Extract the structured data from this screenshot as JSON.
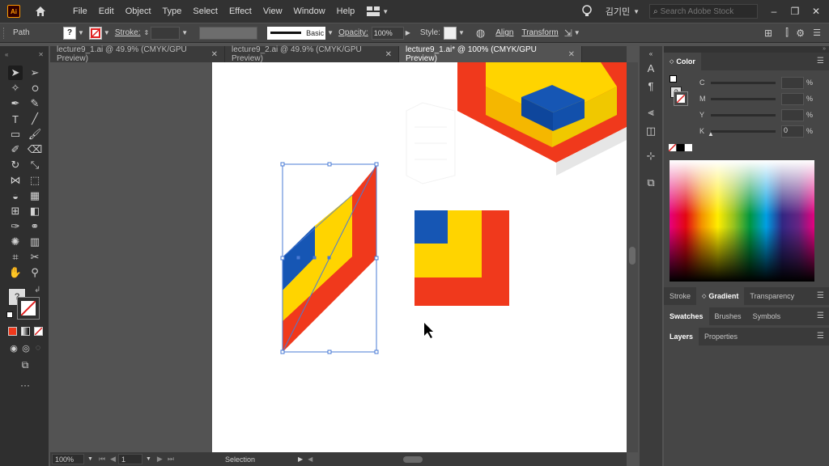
{
  "menubar": {
    "logo": "Ai",
    "items": [
      "File",
      "Edit",
      "Object",
      "Type",
      "Select",
      "Effect",
      "View",
      "Window",
      "Help"
    ],
    "user_name": "김기민",
    "search_placeholder": "Search Adobe Stock"
  },
  "controlbar": {
    "object_type": "Path",
    "stroke_label": "Stroke:",
    "stroke_style": "Basic",
    "opacity_label": "Opacity:",
    "opacity_value": "100%",
    "style_label": "Style:",
    "align_label": "Align",
    "transform_label": "Transform"
  },
  "tabs": [
    {
      "label": "lecture9_1.ai @ 49.9% (CMYK/GPU Preview)",
      "active": false
    },
    {
      "label": "lecture9_2.ai @ 49.9% (CMYK/GPU Preview)",
      "active": false
    },
    {
      "label": "lecture9_1.ai* @ 100% (CMYK/GPU Preview)",
      "active": true
    }
  ],
  "statusbar": {
    "zoom": "100%",
    "artboard_number": "1",
    "tool_name": "Selection"
  },
  "panels": {
    "color": {
      "title": "Color",
      "channels": [
        {
          "label": "C",
          "value": ""
        },
        {
          "label": "M",
          "value": ""
        },
        {
          "label": "Y",
          "value": ""
        },
        {
          "label": "K",
          "value": "0"
        }
      ],
      "unit": "%"
    },
    "group2": {
      "tabs": [
        "Stroke",
        "Gradient",
        "Transparency"
      ],
      "active": "Gradient"
    },
    "group3": {
      "tabs": [
        "Swatches",
        "Brushes",
        "Symbols"
      ],
      "active": "Swatches"
    },
    "group4": {
      "tabs": [
        "Layers",
        "Properties"
      ],
      "active": "Layers"
    }
  },
  "colors": {
    "red": "#f0391c",
    "yellow": "#ffd400",
    "blue": "#1656b4",
    "selection": "#4a7bd6",
    "artboard": "#ffffff"
  }
}
